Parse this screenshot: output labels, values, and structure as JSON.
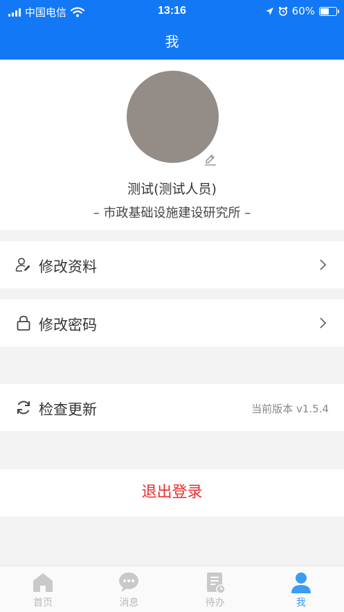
{
  "status_bar": {
    "carrier": "中国电信",
    "time": "13:16",
    "battery_percent": "60%",
    "battery_level": 0.6
  },
  "header": {
    "title": "我"
  },
  "profile": {
    "name": "测试(测试人员)",
    "organization": "– 市政基础设施建设研究所 –"
  },
  "menu": {
    "edit_profile": "修改资料",
    "change_password": "修改密码",
    "check_update": "检查更新",
    "version": "当前版本 v1.5.4"
  },
  "logout_label": "退出登录",
  "tabs": [
    {
      "label": "首页",
      "icon": "home-icon"
    },
    {
      "label": "消息",
      "icon": "message-icon"
    },
    {
      "label": "待办",
      "icon": "todo-icon"
    },
    {
      "label": "我",
      "icon": "user-icon"
    }
  ],
  "colors": {
    "primary": "#1378f6",
    "logout": "#ec2b2b",
    "active_tab": "#3a9cf2",
    "inactive_tab": "#b9b9b9"
  }
}
